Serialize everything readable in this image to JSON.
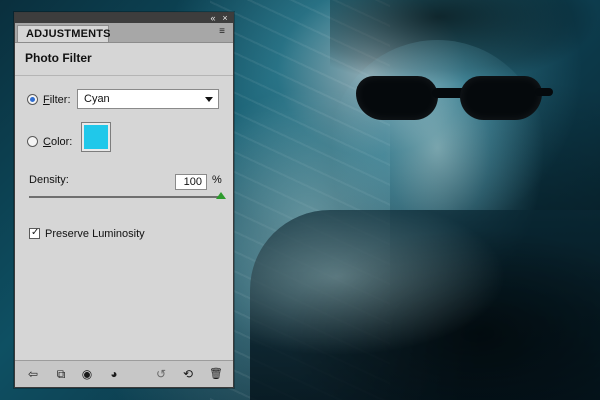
{
  "panel": {
    "tab_label": "ADJUSTMENTS",
    "title": "Photo Filter",
    "filter": {
      "label_prefix": "",
      "label_underlined": "F",
      "label_rest": "ilter:",
      "selected": "Cyan",
      "selected_state": "checked"
    },
    "color": {
      "label_prefix": "",
      "label_underlined": "C",
      "label_rest": "olor:",
      "swatch_hex": "#20c8ea",
      "selected_state": "unchecked"
    },
    "density": {
      "label_prefix": "",
      "label_underlined": "D",
      "label_rest": "ensity:",
      "value": "100",
      "unit": "%",
      "level_percent": 100
    },
    "preserve_luminosity": {
      "label": "Preserve Luminosity",
      "checked": true,
      "tick": "✓"
    }
  },
  "icons": {
    "topbar": {
      "collapse": "«",
      "close": "×"
    },
    "panel_menu": "≡",
    "bottombar": [
      {
        "name": "back-arrow-icon",
        "glyph": "⇦"
      },
      {
        "name": "expand-view-icon",
        "glyph": "⧉"
      },
      {
        "name": "clip-to-layer-icon",
        "glyph": "◉"
      },
      {
        "name": "visibility-eye-icon",
        "glyph": "◕"
      },
      {
        "name": "previous-state-icon",
        "glyph": "↺"
      },
      {
        "name": "reset-icon",
        "glyph": "⟲"
      },
      {
        "name": "trash-icon",
        "glyph": "🗑"
      }
    ]
  }
}
